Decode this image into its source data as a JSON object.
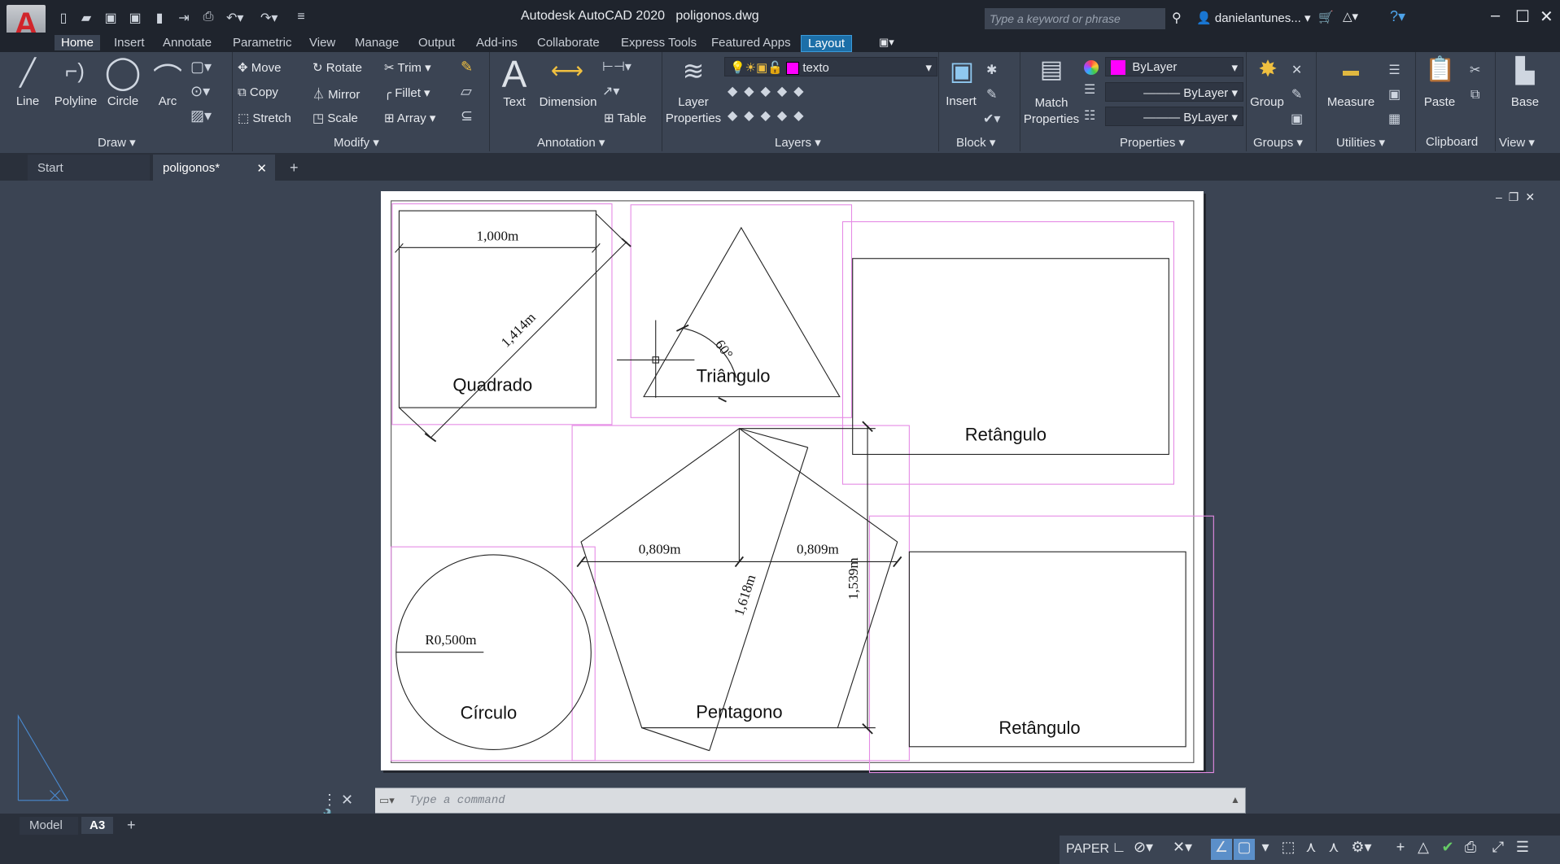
{
  "app": {
    "title": "Autodesk AutoCAD 2020",
    "filename": "poligonos.dwg",
    "logo": "A",
    "search_placeholder": "Type a keyword or phrase",
    "user": "danielantunes...",
    "accent": "#1c6fa8"
  },
  "ribbon_tabs": [
    "Home",
    "Insert",
    "Annotate",
    "Parametric",
    "View",
    "Manage",
    "Output",
    "Add-ins",
    "Collaborate",
    "Express Tools",
    "Featured Apps",
    "Layout"
  ],
  "draw": {
    "line": "Line",
    "polyline": "Polyline",
    "circle": "Circle",
    "arc": "Arc",
    "panel": "Draw"
  },
  "modify": {
    "move": "Move",
    "rotate": "Rotate",
    "trim": "Trim",
    "copy": "Copy",
    "mirror": "Mirror",
    "fillet": "Fillet",
    "stretch": "Stretch",
    "scale": "Scale",
    "array": "Array",
    "panel": "Modify"
  },
  "annotation": {
    "text": "Text",
    "dimension": "Dimension",
    "table": "Table",
    "panel": "Annotation"
  },
  "layers": {
    "properties": "Layer Properties",
    "current": "texto",
    "current_color": "#ff00ff",
    "panel": "Layers"
  },
  "block": {
    "insert": "Insert",
    "panel": "Block"
  },
  "properties": {
    "match": "Match Properties",
    "color": "ByLayer",
    "linetype": "ByLayer",
    "lineweight": "ByLayer",
    "panel": "Properties"
  },
  "groups": {
    "group": "Group",
    "panel": "Groups"
  },
  "utilities": {
    "measure": "Measure",
    "panel": "Utilities"
  },
  "clipboard": {
    "paste": "Paste",
    "panel": "Clipboard"
  },
  "view": {
    "base": "Base",
    "panel": "View"
  },
  "doc_tabs": [
    "Start",
    "poligonos*"
  ],
  "drawing": {
    "labels": {
      "square": "Quadrado",
      "triangle": "Triângulo",
      "rect1": "Retângulo",
      "circle": "Círculo",
      "pentagon": "Pentagono",
      "rect2": "Retângulo"
    },
    "dims": {
      "square_side": "1,000m",
      "square_diag": "1,414m",
      "angle": "60°",
      "radius": "R0,500m",
      "pent_left": "0,809m",
      "pent_right": "0,809m",
      "pent_diag": "1,618m",
      "pent_height": "1,539m"
    },
    "boundary_color": "#e58be5"
  },
  "command": {
    "placeholder": "Type a command"
  },
  "layout_tabs": [
    "Model",
    "A3"
  ],
  "status": {
    "space": "PAPER"
  }
}
